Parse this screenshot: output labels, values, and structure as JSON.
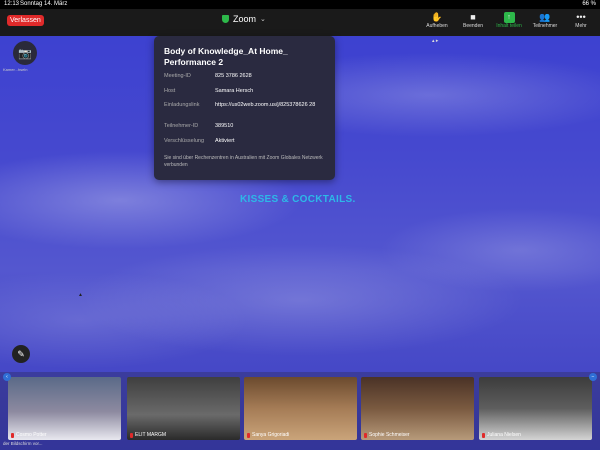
{
  "status": {
    "time": "12:13",
    "date": "Sonntag 14. März",
    "battery": "66 %"
  },
  "topbar": {
    "leave_label": "Verlassen",
    "app_title": "Zoom",
    "tools": [
      {
        "icon": "raise-hand-icon",
        "label": "Aufheben"
      },
      {
        "icon": "stop-video-icon",
        "label": "Beenden"
      },
      {
        "icon": "share-icon",
        "label": "Inhalt teilen"
      },
      {
        "icon": "participants-icon",
        "label": "Teilnehmer"
      },
      {
        "icon": "more-icon",
        "label": "Mehr"
      }
    ]
  },
  "camera_label": "Kamer...hseln",
  "info": {
    "title": "Body of Knowledge_At Home_ Performance 2",
    "rows": [
      {
        "k": "Meeting-ID",
        "v": "825 3786 2628"
      },
      {
        "k": "Host",
        "v": "Samara Hersch"
      },
      {
        "k": "Einladungslink",
        "v": "https://us02web.zoom.us/j/825378626 28"
      },
      {
        "k": "Teilnehmer-ID",
        "v": "389510"
      },
      {
        "k": "Verschlüsselung",
        "v": "Aktiviert"
      }
    ],
    "footer": "Sie sind über Rechenzentren in Australien mit Zoom Globales Netzwerk verbunden"
  },
  "banner": "KISSES & COCKTAILS.",
  "participants": [
    "Cosmo Potter",
    "ELIT MARGM",
    "Sanya Grigoriadi",
    "Sophie Schmeiser",
    "Juliana Nielsen"
  ],
  "bottom_text": "der Bildschirm vor..."
}
